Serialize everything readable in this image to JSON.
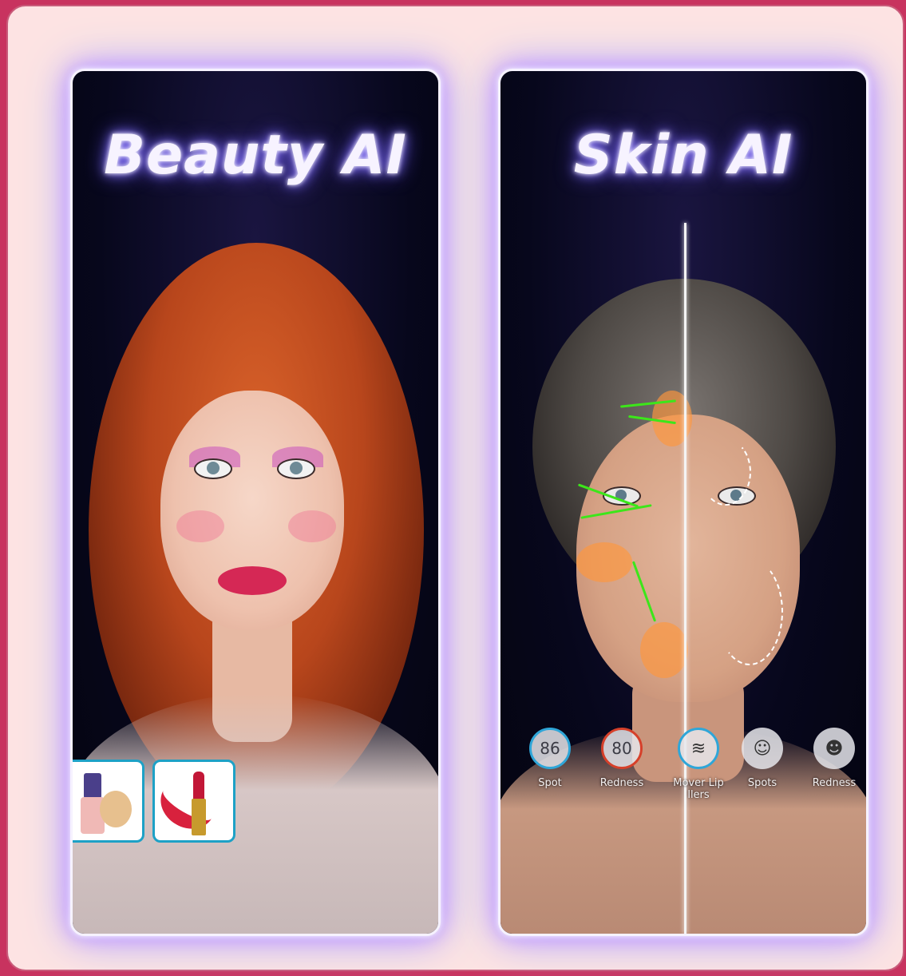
{
  "left_panel": {
    "title": "Beauty AI"
  },
  "right_panel": {
    "title": "Skin AI",
    "metrics": [
      {
        "value": "86",
        "label": "Spot",
        "ring_color": "#2fa6d8"
      },
      {
        "value": "80",
        "label": "Redness",
        "ring_color": "#d6402a"
      },
      {
        "value": "",
        "label": "Mover Lip llers",
        "icon": "lips-icon"
      },
      {
        "value": "",
        "label": "Spots",
        "icon": "face-spots-icon"
      },
      {
        "value": "",
        "label": "Redness",
        "icon": "face-redness-icon"
      }
    ]
  },
  "colors": {
    "background": "#fde3e3",
    "frame_border": "#c95b7a",
    "glow": "#b7a4ff"
  }
}
